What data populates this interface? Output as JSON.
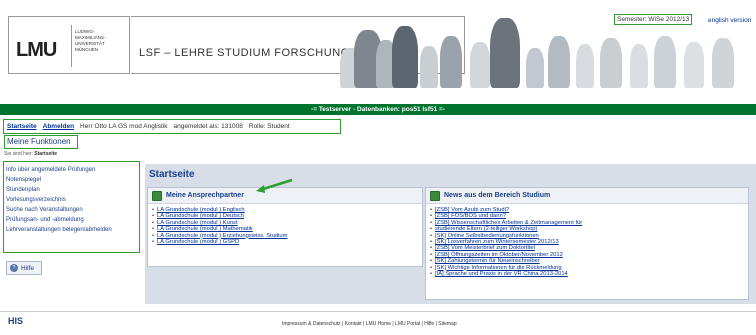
{
  "header": {
    "logo_text": "LMU",
    "logo_sub": [
      "LUDWIG-",
      "MAXIMILIANS-",
      "UNIVERSITÄT",
      "MÜNCHEN"
    ],
    "title": "LSF – LEHRE STUDIUM FORSCHUNG",
    "semester": "Semester: WiSe 2012/13",
    "language": "english version"
  },
  "server_bar": "-= Testserver - Datenbanken: pos51 lsf51 =-",
  "user_bar": {
    "start": "Startseite",
    "logout": "Abmelden",
    "user": "Herr Otto LA GS mod Anglistik",
    "login_as": "angemeldet als: 131008",
    "role": "Rolle: Student"
  },
  "functions": "Meine Funktionen",
  "breadcrumb": {
    "prefix": "Sie sind hier:",
    "current": "Startseite"
  },
  "sidenav": [
    "Info über angemeldete Prüfungen",
    "Notenspiegel",
    "Stundenplan",
    "Vorlesungsverzeichnis",
    "Suche nach Veranstaltungen",
    "Prüfungsan- und -abmeldung",
    "Lehrveranstaltungen belegen/abmelden"
  ],
  "help": "Hilfe",
  "content": {
    "title": "Startseite",
    "contacts": {
      "heading": "Meine Ansprechpartner",
      "items": [
        "LA Grundschule (modul ) Englisch",
        "LA Grundschule (modul ) Deutsch",
        "LA Grundschule (modul ) Kunst",
        "LA Grundschule (modul ) Mathematik",
        "LA Grundschule (modul ) Erziehungswiss. Studium",
        "LA Grundschule (modul ) GSPD"
      ]
    },
    "news": {
      "heading": "News aus dem Bereich Studium",
      "items": [
        "[ZSB] Vom Azubi zum Studi?",
        "[ZSB] FOS/BOS und dann?",
        "[ZSB] Wissenschaftliches Arbeiten & Zeitmanagement für",
        "studierende Eltern (2-teiliger Workshop)",
        "[SK] Online Selbstbedienungsfunktionen",
        "[SK] Losverfahren zum Wintersemester 2012/13",
        "[ZSB] Vom Meisterbrief zum Doktortitel",
        "[ZSB] Öffnungszeiten im Oktober/November 2012",
        "[SK] Zahlungstermin für Neueinschreiber",
        "[SK] Wichtige Informationen für die Rückmeldung",
        "[IA] Sprache und Praxis in der VR China 2013-2014"
      ]
    }
  },
  "footer": {
    "logo": "HIS",
    "links": "Impressum & Datenschutz | Kontakt | LMU Home | LMU Portal | Hilfe | Sitemap"
  },
  "colors": {
    "green_bar": "#00732e",
    "highlight": "#2e9e2e",
    "link": "#003399"
  }
}
